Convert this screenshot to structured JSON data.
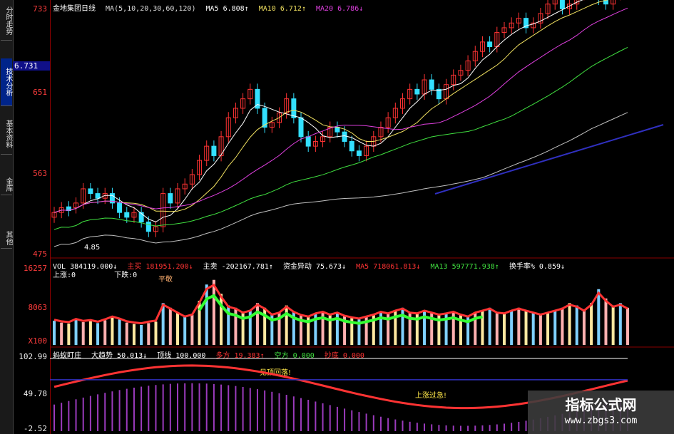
{
  "sidebar": {
    "tabs": [
      {
        "label": "分时走势",
        "active": false
      },
      {
        "label": "技术分析",
        "active": true
      },
      {
        "label": "基本资料",
        "active": false
      },
      {
        "label": "金库",
        "active": false
      },
      {
        "label": "其他",
        "active": false
      }
    ]
  },
  "price_panel": {
    "title": "金地集团日线",
    "ma_params": "MA(5,10,20,30,60,120)",
    "ma5": "MA5  6.808↑",
    "ma10": "MA10  6.712↑",
    "ma20": "MA20  6.786↓",
    "current_price": "6.731",
    "ylabels": [
      "733",
      "651",
      "563",
      "475"
    ],
    "low_label": "4.85"
  },
  "volume_panel": {
    "vol": "VOL  384119.000↓",
    "main_buy": "主买  181951.200↓",
    "main_sell": "主卖  -202167.781↑",
    "fund_flow": "资金异动  75.673↓",
    "ma5": "MA5  718061.813↓",
    "ma13": "MA13  597771.938↑",
    "turnover": "换手率%  0.859↓",
    "ma_extra": "T18061.813↓",
    "rise_label": "上涨:0",
    "fall_label": "下跌:0",
    "yes_label": "平敬",
    "ylabels": [
      "16257",
      "8063",
      "X100"
    ]
  },
  "indicator_panel": {
    "name": "蚂蚁盯庄",
    "trend": "大趋势  50.013↓",
    "top": "顶线  100.000",
    "bull": "多方  19.383↑",
    "bear": "空方  0.000",
    "low": "抄底  0.000",
    "ylabels": [
      "102.99",
      "49.78",
      "-2.52"
    ],
    "anno1": "见顶回落!",
    "anno2": "上涨过急!"
  },
  "watermark": {
    "line1": "指标公式网",
    "line2": "www.zbgs3.com"
  },
  "colors": {
    "up": "#ff3333",
    "down": "#33e0ff",
    "ma5": "#ffffff",
    "ma10": "#f0e060",
    "ma20": "#e040e0",
    "ma30": "#40e040",
    "ma60": "#c0c0c0",
    "ma120": "#3030c0"
  },
  "chart_data": [
    {
      "type": "candlestick",
      "title": "金地集团日线",
      "ylabels": [
        733,
        651,
        563,
        475
      ],
      "ylim": [
        475,
        733
      ],
      "series": [
        {
          "name": "MA5",
          "value": 6.808
        },
        {
          "name": "MA10",
          "value": 6.712
        },
        {
          "name": "MA20",
          "value": 6.786
        }
      ],
      "close": [
        520,
        525,
        522,
        530,
        545,
        540,
        535,
        540,
        530,
        520,
        515,
        520,
        510,
        500,
        505,
        540,
        530,
        545,
        550,
        560,
        575,
        590,
        580,
        600,
        620,
        630,
        640,
        650,
        630,
        610,
        615,
        625,
        640,
        620,
        600,
        590,
        595,
        600,
        610,
        605,
        595,
        585,
        580,
        590,
        600,
        610,
        620,
        630,
        640,
        650,
        645,
        660,
        650,
        640,
        655,
        665,
        670,
        680,
        690,
        700,
        695,
        710,
        715,
        720,
        725,
        715,
        720,
        730,
        740,
        745,
        735,
        740,
        750,
        755,
        760,
        745,
        740,
        750,
        760,
        765
      ],
      "open": [
        515,
        520,
        526,
        525,
        530,
        545,
        540,
        535,
        540,
        530,
        520,
        515,
        520,
        510,
        500,
        505,
        540,
        530,
        545,
        550,
        560,
        575,
        590,
        580,
        600,
        620,
        630,
        640,
        650,
        630,
        610,
        615,
        625,
        640,
        620,
        600,
        590,
        595,
        600,
        610,
        605,
        595,
        585,
        580,
        590,
        600,
        610,
        620,
        630,
        640,
        650,
        645,
        660,
        650,
        640,
        655,
        665,
        670,
        680,
        690,
        700,
        695,
        710,
        715,
        720,
        725,
        715,
        720,
        730,
        740,
        745,
        735,
        740,
        750,
        755,
        760,
        745,
        740,
        750,
        760
      ]
    },
    {
      "type": "bar",
      "title": "VOL",
      "ylabels": [
        16257,
        8063
      ],
      "values": [
        5200,
        4800,
        4600,
        5400,
        4900,
        5100,
        4700,
        5300,
        6000,
        5500,
        4800,
        4500,
        4300,
        4700,
        5000,
        9000,
        8000,
        7000,
        6000,
        6500,
        9500,
        13000,
        14000,
        11000,
        8500,
        8000,
        7000,
        7500,
        9000,
        8000,
        6500,
        7000,
        8500,
        7200,
        6400,
        6000,
        6800,
        7200,
        6500,
        7000,
        6200,
        5800,
        5500,
        6000,
        6500,
        7200,
        6800,
        7500,
        8000,
        7000,
        6800,
        7500,
        7000,
        6500,
        6800,
        7200,
        6500,
        6000,
        7000,
        7500,
        8000,
        7000,
        6800,
        7500,
        8000,
        7500,
        7000,
        6500,
        7000,
        7500,
        8000,
        9000,
        8500,
        7500,
        9000,
        12000,
        10000,
        8500,
        9000,
        8000
      ]
    },
    {
      "type": "line",
      "title": "蚂蚁盯庄",
      "ylabels": [
        102.99,
        49.78,
        -2.52
      ],
      "ylim": [
        -2.52,
        102.99
      ],
      "series": [
        {
          "name": "大趋势",
          "value": 50.013
        },
        {
          "name": "顶线",
          "value": 100.0
        },
        {
          "name": "多方",
          "value": 19.383
        },
        {
          "name": "空方",
          "value": 0.0
        },
        {
          "name": "抄底",
          "value": 0.0
        }
      ]
    }
  ]
}
